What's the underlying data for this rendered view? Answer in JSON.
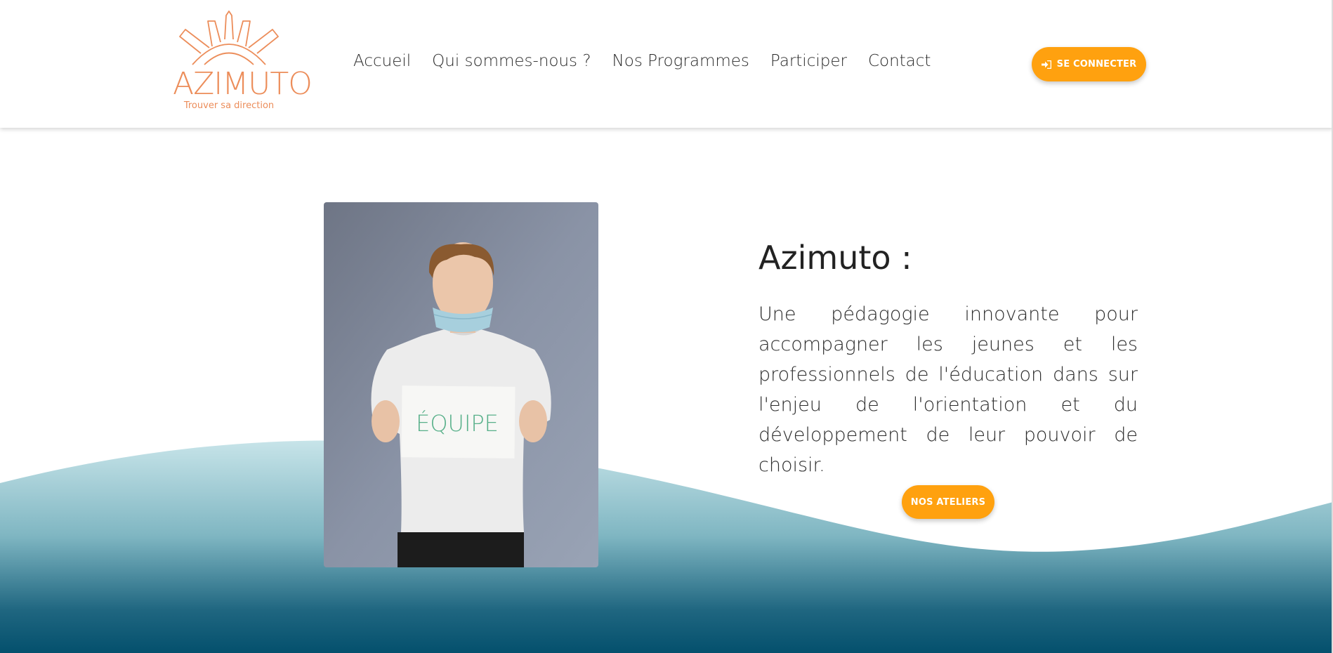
{
  "logo": {
    "name": "AZIMUTO",
    "tagline": "Trouver sa direction"
  },
  "nav": {
    "items": [
      {
        "label": "Accueil"
      },
      {
        "label": "Qui sommes-nous ?"
      },
      {
        "label": "Nos Programmes"
      },
      {
        "label": "Participer"
      },
      {
        "label": "Contact"
      }
    ]
  },
  "header": {
    "login_label": "SE CONNECTER",
    "login_icon": "sign-in-icon"
  },
  "hero": {
    "title": "Azimuto :",
    "description": "Une pédagogie innovante pour accompagner les jeunes et les professionnels de l'éducation dans sur l'enjeu de l'orientation et du développement de leur pouvoir de choisir.",
    "cta_label": "NOS ATELIERS",
    "photo_sign_text": "ÉQUIPE"
  },
  "colors": {
    "accent": "#ffa10f",
    "logo": "#ec8d5a",
    "wave_top": "#c7e4e9",
    "wave_bottom": "#04506d"
  }
}
